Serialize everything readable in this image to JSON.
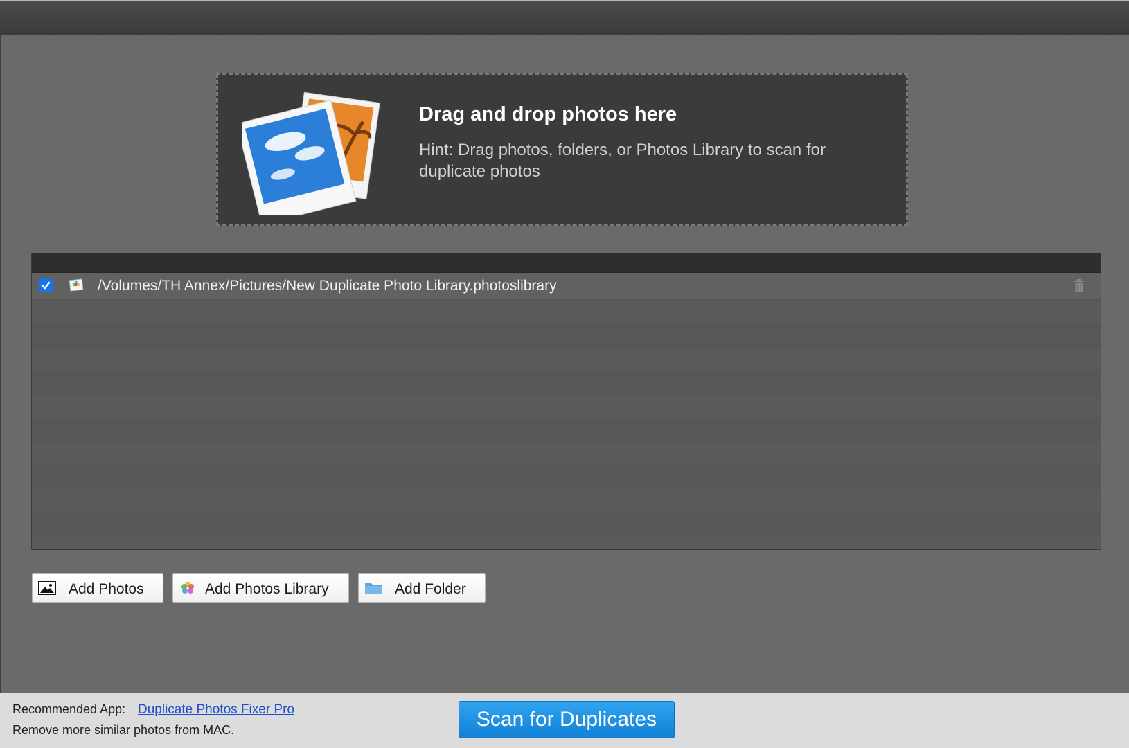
{
  "dropzone": {
    "title": "Drag and drop photos here",
    "hint": "Hint: Drag photos, folders, or Photos Library to scan for duplicate photos",
    "image_icon": "photos-stack-icon"
  },
  "list": {
    "rows": [
      {
        "checked": true,
        "icon": "photos-library-icon",
        "path": "/Volumes/TH Annex/Pictures/New Duplicate Photo Library.photoslibrary"
      }
    ]
  },
  "buttons": {
    "add_photos": "Add Photos",
    "add_photos_library": "Add Photos Library",
    "add_folder": "Add Folder"
  },
  "footer": {
    "recommended_label": "Recommended App:",
    "recommended_link": "Duplicate Photos Fixer Pro",
    "sub_text": "Remove more similar photos from MAC.",
    "scan_button": "Scan for Duplicates"
  },
  "colors": {
    "background": "#6b6a6b",
    "dropzone": "#3c3b3c",
    "accent": "#1a73e8",
    "scan_button": "#1a90e0",
    "link": "#1a4fd1"
  }
}
